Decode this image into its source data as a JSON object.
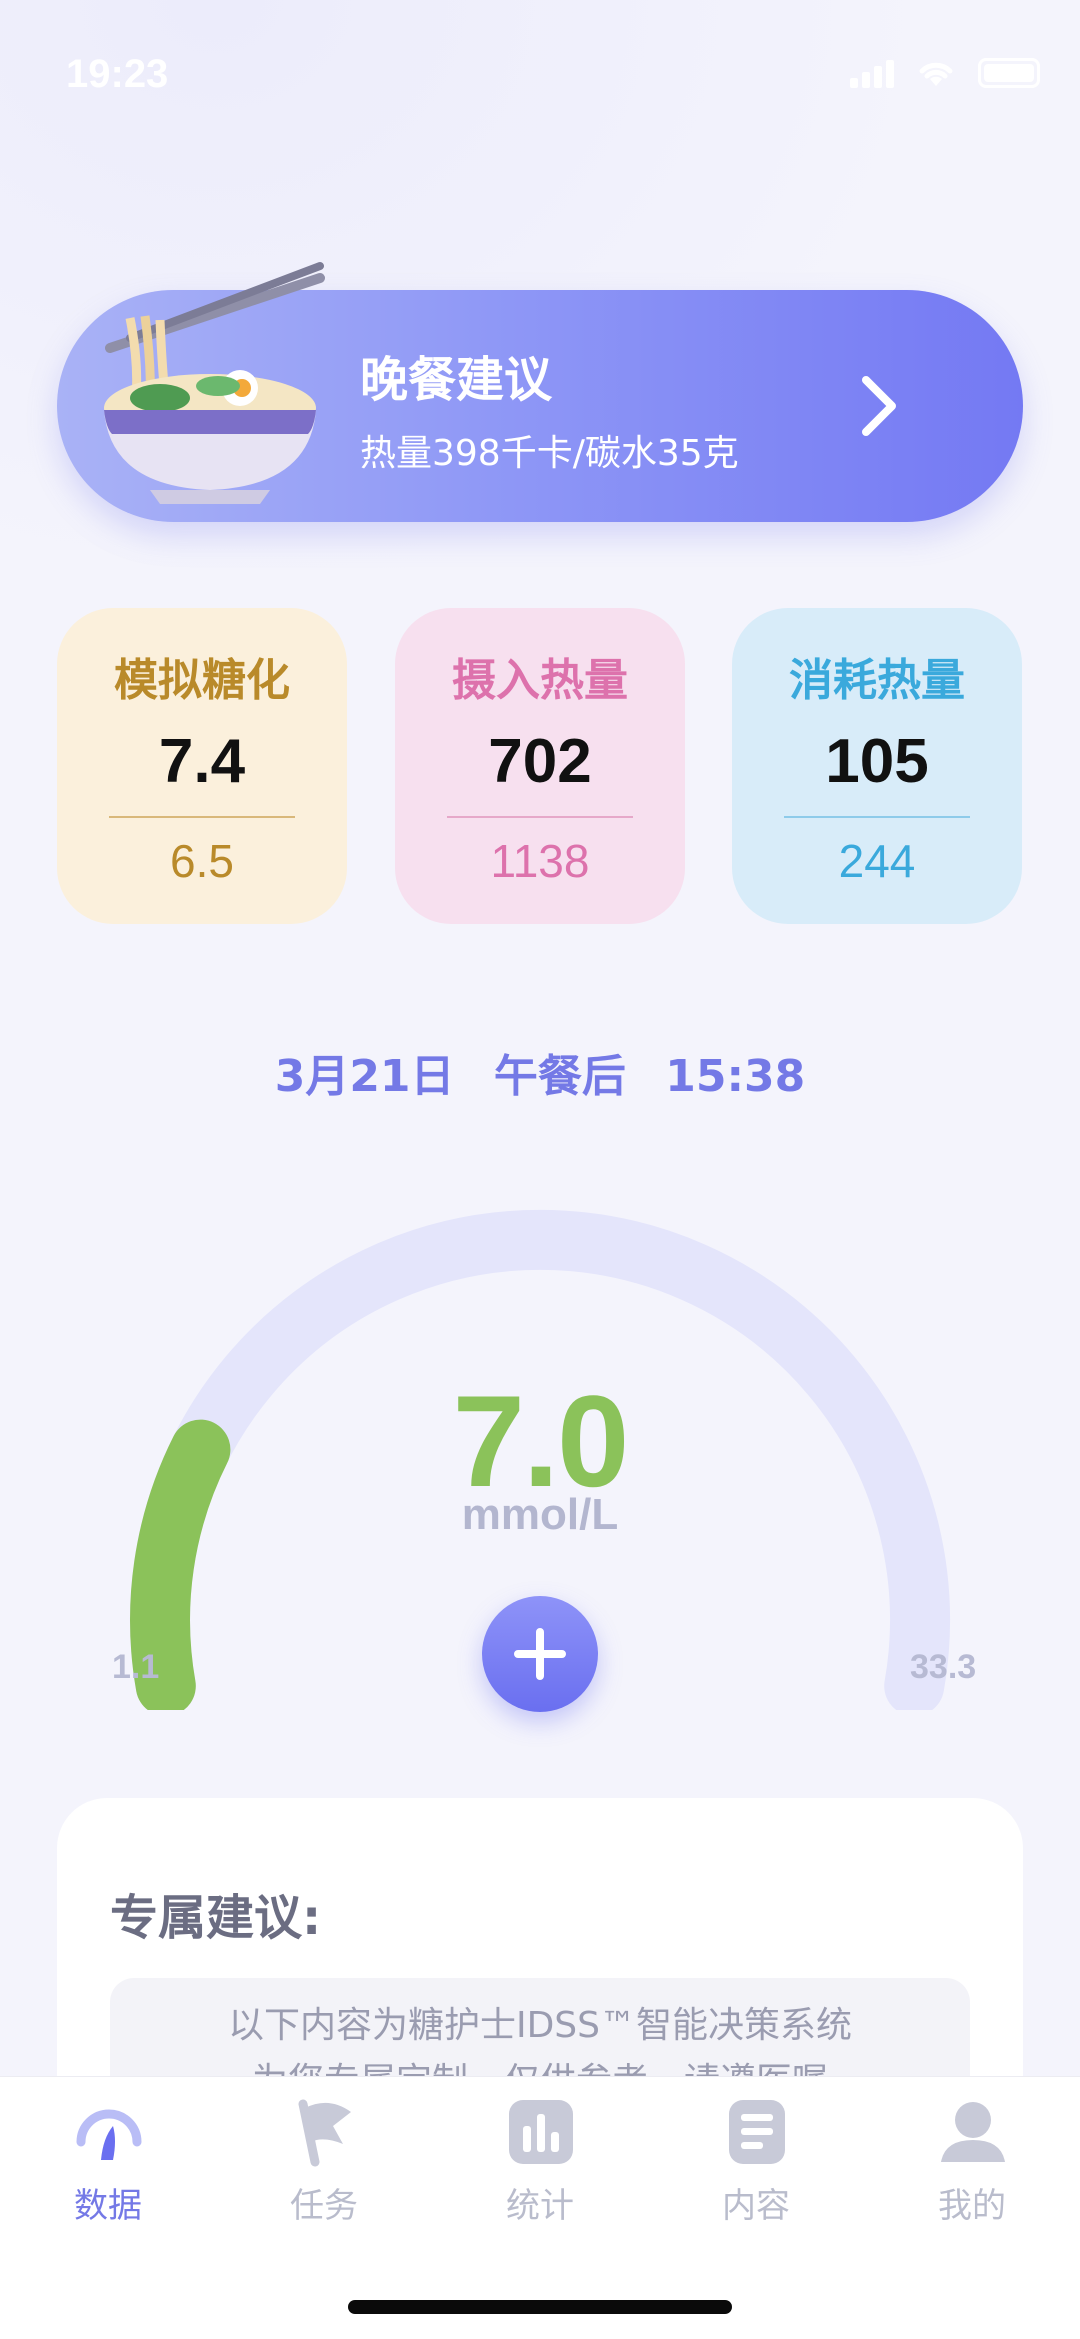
{
  "status": {
    "time": "19:23"
  },
  "dinner": {
    "title": "晚餐建议",
    "subtitle": "热量398千卡/碳水35克",
    "icon": "noodle-bowl-icon"
  },
  "stats": {
    "a1c": {
      "label": "模拟糖化",
      "value": "7.4",
      "sub": "6.5",
      "color": "#b98a2a"
    },
    "intake": {
      "label": "摄入热量",
      "value": "702",
      "sub": "1138",
      "color": "#dd72ac"
    },
    "burn": {
      "label": "消耗热量",
      "value": "105",
      "sub": "244",
      "color": "#3aa9dc"
    }
  },
  "reading": {
    "date": "3月21日",
    "meal": "午餐后",
    "time": "15:38"
  },
  "gauge": {
    "value": "7.0",
    "value_num": 7.0,
    "unit": "mmol/L",
    "min_label": "1.1",
    "max_label": "33.3",
    "min": 1.1,
    "max": 33.3,
    "color_fill": "#8bc25a",
    "color_track": "#e4e5fb"
  },
  "advice": {
    "title": "专属建议:",
    "line1": "以下内容为糖护士IDSS™智能决策系统",
    "line2": "为您专属定制，仅供参考，请遵医嘱"
  },
  "tabs": [
    {
      "label": "数据",
      "icon": "gauge-icon",
      "active": true
    },
    {
      "label": "任务",
      "icon": "flag-icon",
      "active": false
    },
    {
      "label": "统计",
      "icon": "bar-chart-icon",
      "active": false
    },
    {
      "label": "内容",
      "icon": "document-icon",
      "active": false
    },
    {
      "label": "我的",
      "icon": "user-icon",
      "active": false
    }
  ],
  "colors": {
    "accent": "#7479e6",
    "background": "#f4f4fc"
  }
}
